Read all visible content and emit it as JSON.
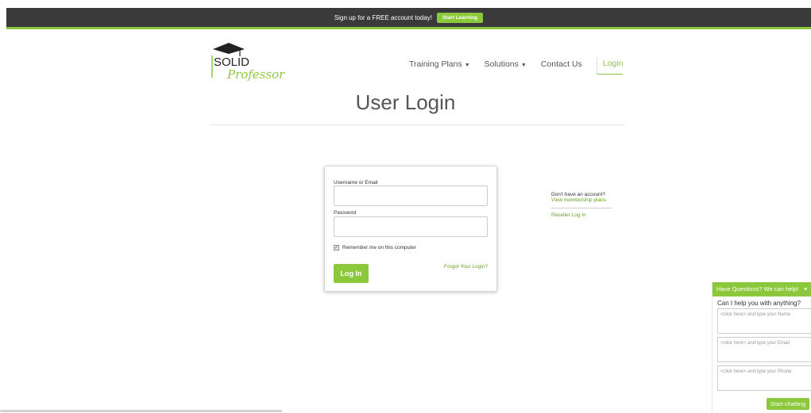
{
  "topbar": {
    "promo_text": "Sign up for a FREE account today!",
    "cta_label": "Start Learning"
  },
  "logo": {
    "line1": "SOLID",
    "line2": "Professor"
  },
  "nav": {
    "items": [
      {
        "label": "Training Plans"
      },
      {
        "label": "Solutions"
      },
      {
        "label": "Contact Us"
      }
    ],
    "login_label": "Login"
  },
  "page": {
    "title": "User Login"
  },
  "login_form": {
    "username_label": "Username or Email",
    "username_value": "",
    "password_label": "Password",
    "password_value": "",
    "remember_label": "Remember me on this computer",
    "remember_checked": true,
    "submit_label": "Log In",
    "forgot_label": "Forgot Your Login?"
  },
  "side": {
    "question": "Don't have an account?",
    "plans_link": "View membership plans",
    "reseller_link": "Reseller Log In"
  },
  "chat": {
    "header": "Have Questions? We can help!",
    "question": "Can I help you with anything?",
    "name_placeholder": "<click here> and type your Name",
    "email_placeholder": "<click here> and type your Email",
    "phone_placeholder": "<click here> and type your Phone",
    "start_label": "Start chatting"
  },
  "colors": {
    "accent": "#8cc83c",
    "topbar": "#3a3a3a",
    "link": "#6aa320"
  }
}
